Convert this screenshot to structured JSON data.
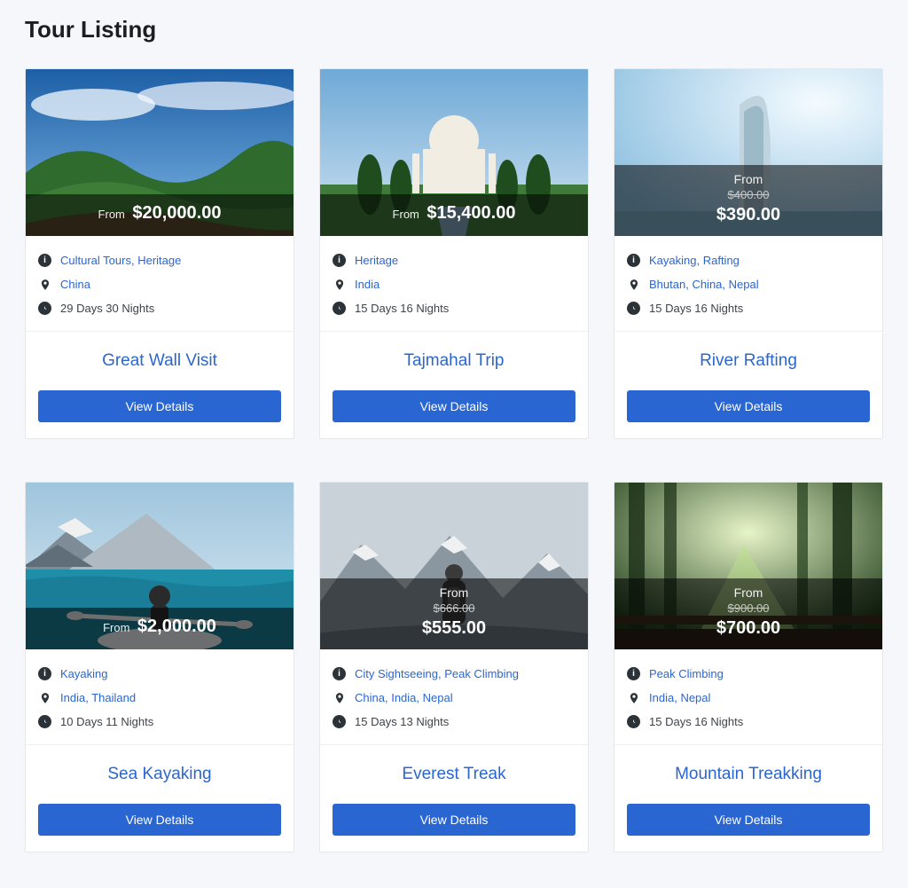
{
  "page_title": "Tour Listing",
  "from_label": "From",
  "view_details_label": "View Details",
  "tours": [
    {
      "title": "Great Wall Visit",
      "price": "$20,000.00",
      "original_price": null,
      "categories": [
        "Cultural Tours",
        "Heritage"
      ],
      "locations": [
        "China"
      ],
      "duration": "29 Days 30 Nights",
      "scenery": "great-wall"
    },
    {
      "title": "Tajmahal Trip",
      "price": "$15,400.00",
      "original_price": null,
      "categories": [
        "Heritage"
      ],
      "locations": [
        "India"
      ],
      "duration": "15 Days 16 Nights",
      "scenery": "taj-mahal"
    },
    {
      "title": "River Rafting",
      "price": "$390.00",
      "original_price": "$400.00",
      "categories": [
        "Kayaking",
        "Rafting"
      ],
      "locations": [
        "Bhutan",
        "China",
        "Nepal"
      ],
      "duration": "15 Days 16 Nights",
      "scenery": "burj"
    },
    {
      "title": "Sea Kayaking",
      "price": "$2,000.00",
      "original_price": null,
      "categories": [
        "Kayaking"
      ],
      "locations": [
        "India",
        "Thailand"
      ],
      "duration": "10 Days 11 Nights",
      "scenery": "kayak"
    },
    {
      "title": "Everest Treak",
      "price": "$555.00",
      "original_price": "$666.00",
      "categories": [
        "City Sightseeing",
        "Peak Climbing"
      ],
      "locations": [
        "China",
        "India",
        "Nepal"
      ],
      "duration": "15 Days 13 Nights",
      "scenery": "everest"
    },
    {
      "title": "Mountain Treakking",
      "price": "$700.00",
      "original_price": "$900.00",
      "categories": [
        "Peak Climbing"
      ],
      "locations": [
        "India",
        "Nepal"
      ],
      "duration": "15 Days 16 Nights",
      "scenery": "forest"
    }
  ]
}
